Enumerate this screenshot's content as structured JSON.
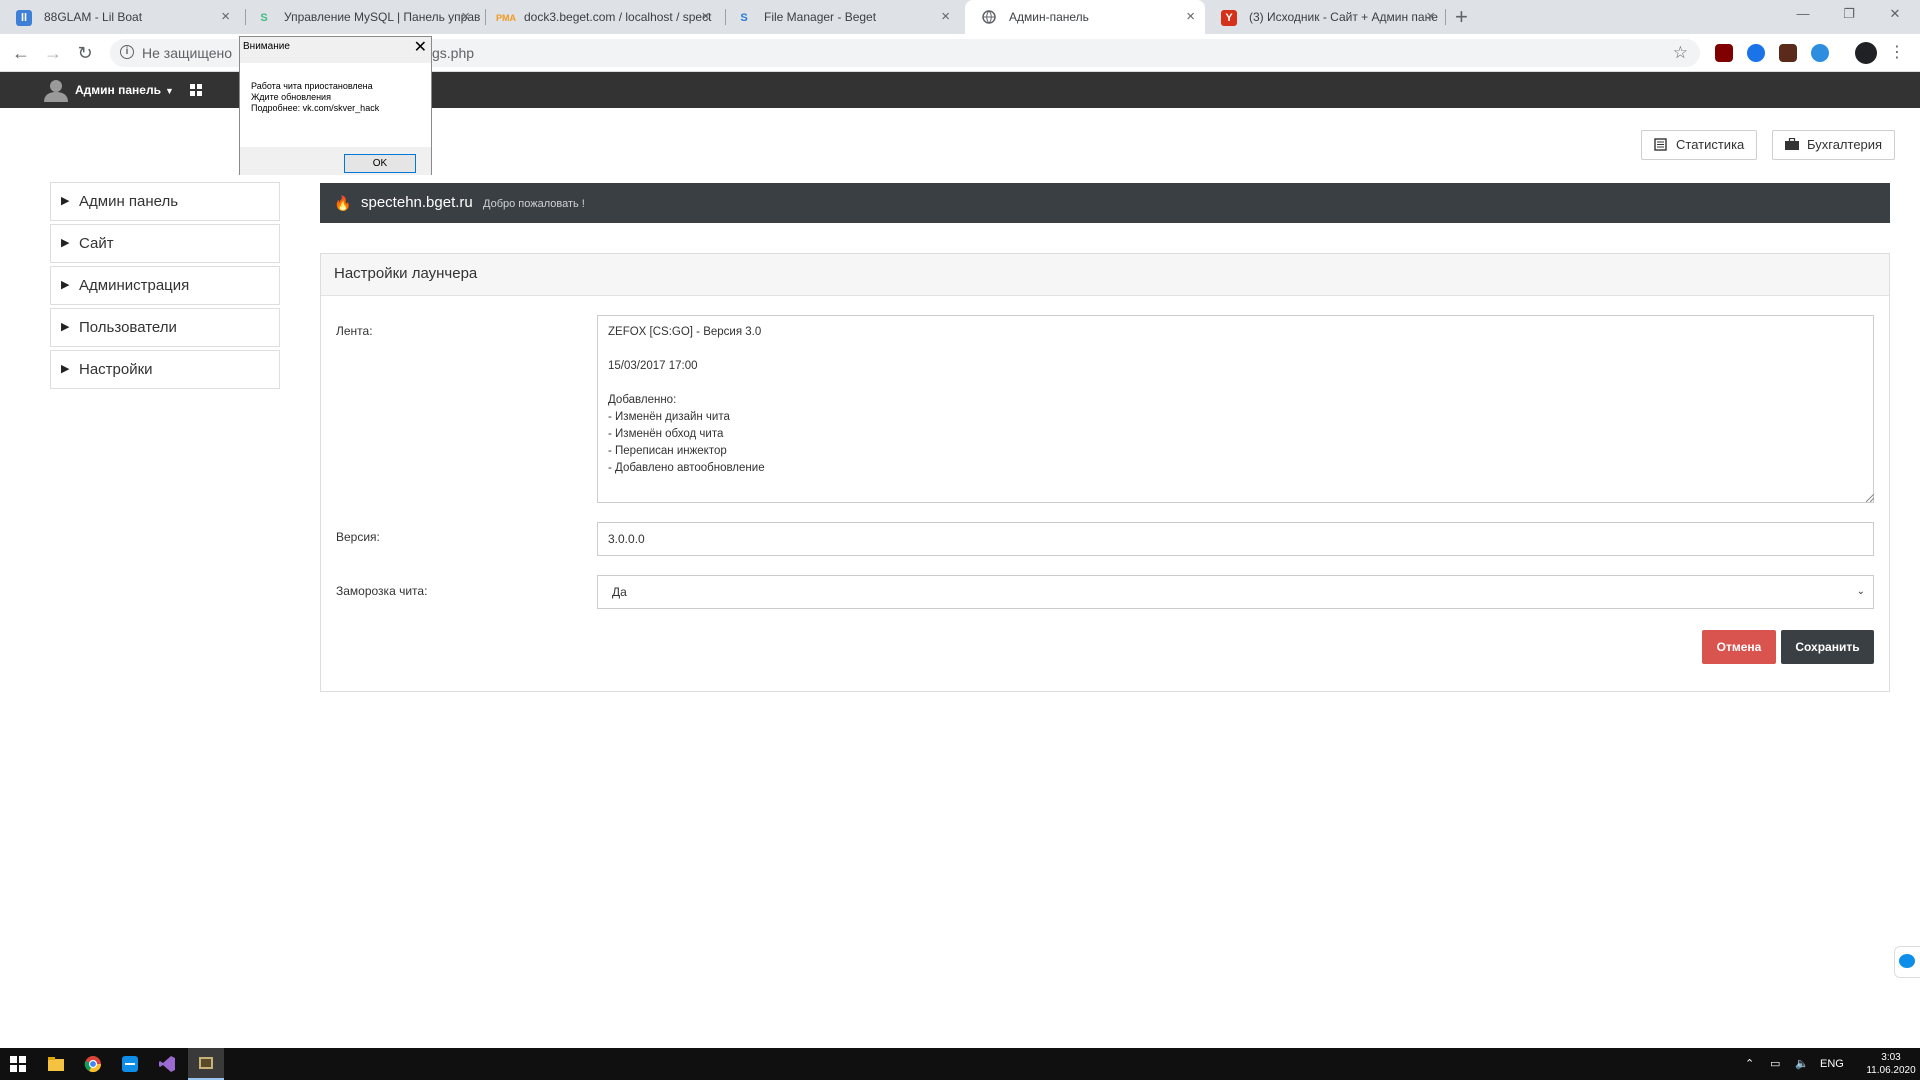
{
  "browser": {
    "tabs": [
      {
        "title": "88GLAM - Lil Boat",
        "icon": "pause-icon",
        "color": "#3f7fd6"
      },
      {
        "title": "Управление MySQL | Панель управ",
        "icon": "s-icon",
        "color": "#3fbf7f"
      },
      {
        "title": "dock3.beget.com / localhost / spect",
        "icon": "pma-icon",
        "color": "#f29a1e"
      },
      {
        "title": "File Manager - Beget",
        "icon": "beget-icon",
        "color": "#2b7bd6"
      },
      {
        "title": "Админ-панель",
        "icon": "globe-icon",
        "color": "#5f6368"
      },
      {
        "title": "(3) Исходник - Сайт + Админ пане",
        "icon": "y-icon",
        "color": "#d5311a"
      }
    ],
    "active_tab": 4,
    "address": {
      "security_label": "Не защищено",
      "url_visible": "gs.php"
    }
  },
  "admin_bar": {
    "user_label": "Админ панель"
  },
  "top_buttons": {
    "stats_label": "Статистика",
    "accounting_label": "Бухгалтерия"
  },
  "sidebar": {
    "items": [
      {
        "label": "Админ панель"
      },
      {
        "label": "Сайт"
      },
      {
        "label": "Администрация"
      },
      {
        "label": "Пользователи"
      },
      {
        "label": "Настройки"
      }
    ]
  },
  "welcome": {
    "site": "spectehn.bget.ru",
    "greeting": "Добро пожаловать !"
  },
  "panel": {
    "title": "Настройки лаунчера",
    "feed_label": "Лента:",
    "feed_value": "ZEFOX [CS:GO] - Версия 3.0\n\n15/03/2017 17:00\n\nДобавленно:\n- Изменён дизайн чита\n- Изменён обход чита\n- Переписан инжектор\n- Добавлено автообновление",
    "version_label": "Версия:",
    "version_value": "3.0.0.0",
    "freeze_label": "Заморозка чита:",
    "freeze_value": "Да",
    "cancel_label": "Отмена",
    "save_label": "Сохранить"
  },
  "dialog": {
    "title": "Внимание",
    "lines": [
      "Работа чита приостановлена",
      "Ждите обновления",
      "Подробнее: vk.com/skver_hack"
    ],
    "ok_label": "OK"
  },
  "taskbar": {
    "lang": "ENG",
    "time": "3:03",
    "date": "11.06.2020"
  },
  "colors": {
    "admin_bar": "#333333",
    "welcome_bar": "#3a3f44",
    "cancel": "#d9534f",
    "save": "#3a3f44"
  }
}
